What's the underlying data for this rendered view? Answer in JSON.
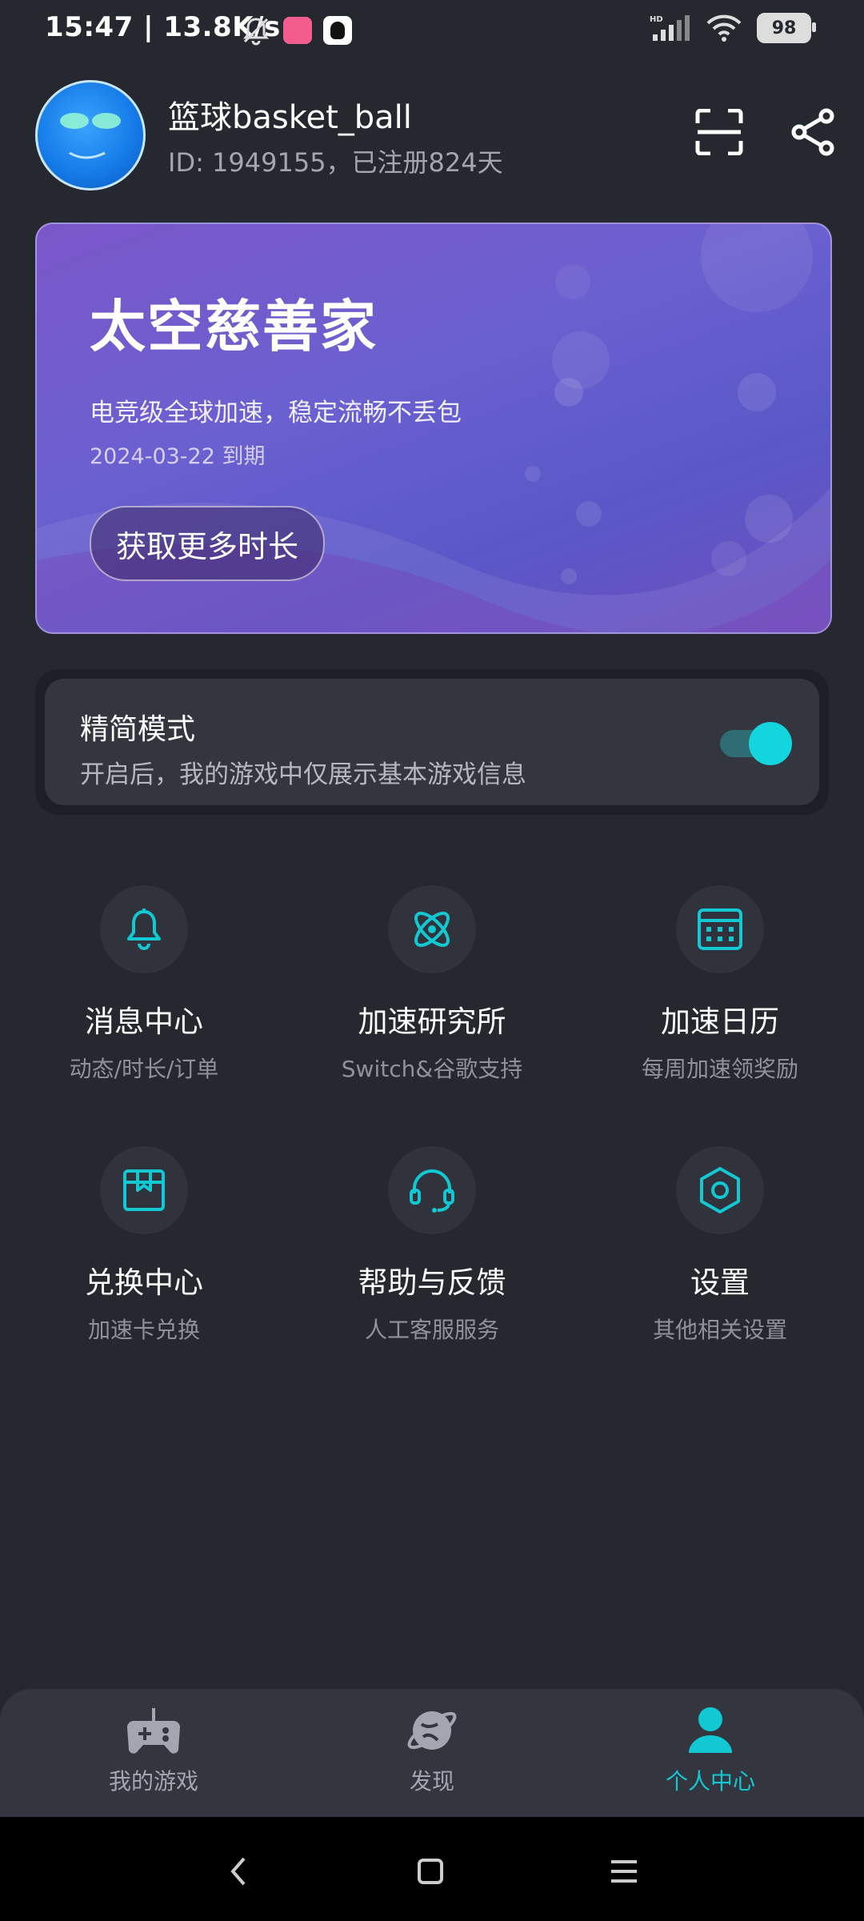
{
  "status_bar": {
    "time_speed": "15:47 | 13.8K/s",
    "battery": "98"
  },
  "profile": {
    "username": "篮球basket_ball",
    "user_id_line": "ID: 1949155，已注册824天"
  },
  "vip_card": {
    "title": "太空慈善家",
    "description": "电竞级全球加速，稳定流畅不丢包",
    "expiry": "2024-03-22 到期",
    "button_label": "获取更多时长"
  },
  "mode": {
    "title": "精简模式",
    "subtitle": "开启后，我的游戏中仅展示基本游戏信息",
    "enabled": true
  },
  "grid_items": [
    {
      "title": "消息中心",
      "subtitle": "动态/时长/订单",
      "icon": "bell-icon"
    },
    {
      "title": "加速研究所",
      "subtitle": "Switch&谷歌支持",
      "icon": "atom-icon"
    },
    {
      "title": "加速日历",
      "subtitle": "每周加速领奖励",
      "icon": "calendar-icon"
    },
    {
      "title": "兑换中心",
      "subtitle": "加速卡兑换",
      "icon": "gift-box-icon"
    },
    {
      "title": "帮助与反馈",
      "subtitle": "人工客服服务",
      "icon": "headset-icon"
    },
    {
      "title": "设置",
      "subtitle": "其他相关设置",
      "icon": "settings-hexagon-icon"
    }
  ],
  "tabs": [
    {
      "label": "我的游戏",
      "icon": "gamepad-icon"
    },
    {
      "label": "发现",
      "icon": "planet-icon"
    },
    {
      "label": "个人中心",
      "icon": "person-icon",
      "active": true
    }
  ],
  "colors": {
    "background": "#262830",
    "accent": "#12c8d2",
    "card_purple": "#6b60d0"
  }
}
